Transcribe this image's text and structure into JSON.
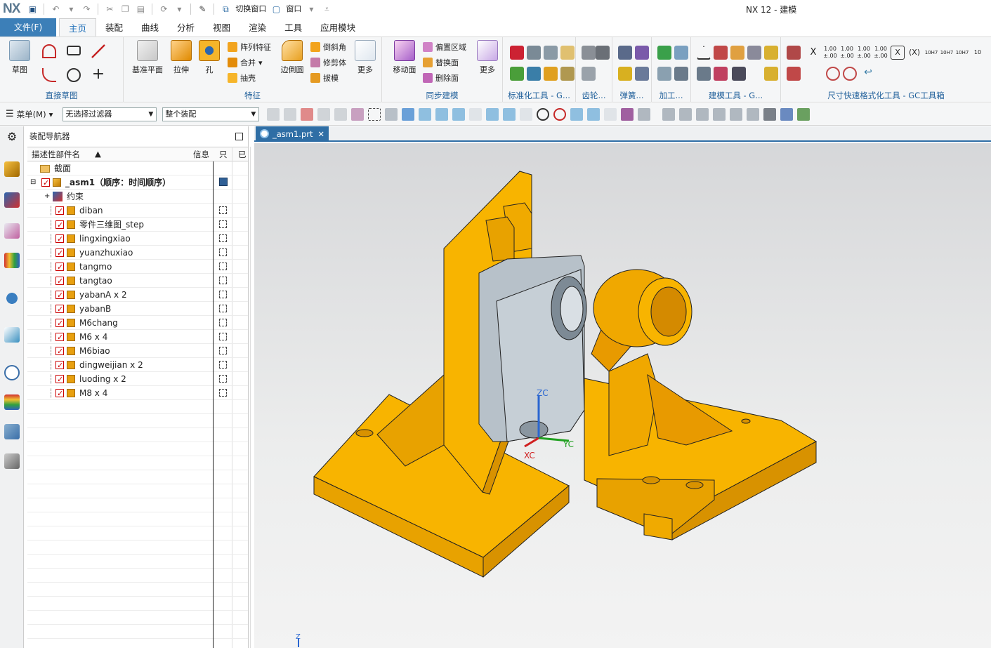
{
  "app": {
    "logo": "NX",
    "title": "NX 12 - 建模"
  },
  "quick_access": {
    "switch_window": "切换窗口",
    "window": "窗口"
  },
  "menubar": {
    "file": "文件(F)",
    "tabs": [
      "主页",
      "装配",
      "曲线",
      "分析",
      "视图",
      "渲染",
      "工具",
      "应用模块"
    ]
  },
  "ribbon": {
    "sketch": {
      "label": "草图",
      "group": "直接草图"
    },
    "feature": {
      "datum": "基准平面",
      "extrude": "拉伸",
      "hole": "孔",
      "pattern": "阵列特征",
      "unite": "合并",
      "shell": "抽壳",
      "edge_blend": "边倒圆",
      "chamfer": "倒斜角",
      "trim_body": "修剪体",
      "draft": "拔模",
      "more": "更多",
      "group": "特征"
    },
    "sync": {
      "move_face": "移动面",
      "offset_region": "偏置区域",
      "replace_face": "替换面",
      "delete_face": "删除面",
      "more": "更多",
      "group": "同步建模"
    },
    "std_tools": "标准化工具 - G...",
    "gear": "齿轮...",
    "spring": "弹簧...",
    "machining": "加工...",
    "build_tools": "建模工具 - G...",
    "dim_tools": "尺寸快速格式化工具 - GC工具箱",
    "dim_labels": [
      "X",
      "(X)",
      "10H7",
      "10H7",
      "10H7",
      "10"
    ]
  },
  "toolbar2": {
    "menu": "菜单(M)",
    "filter": "无选择过滤器",
    "assembly": "整个装配"
  },
  "navigator": {
    "title": "装配导航器",
    "col_name": "描述性部件名",
    "col_info": "信息",
    "col_ro": "只",
    "col_mod": "已",
    "section": "截面",
    "root": "_asm1（顺序：时间顺序）",
    "constraints": "约束",
    "parts": [
      "diban",
      "零件三维图_step",
      "lingxingxiao",
      "yuanzhuxiao",
      "tangmo",
      "tangtao",
      "yabanA x 2",
      "yabanB",
      "M6chang",
      "M6 x 4",
      "M6biao",
      "dingweijian x 2",
      "luoding x 2",
      "M8 x 4"
    ]
  },
  "doc_tab": "_asm1.prt",
  "viewport": {
    "axis_zc": "ZC",
    "axis_xc": "XC",
    "axis_yc": "YC",
    "triad_z": "Z"
  },
  "colors": {
    "accent": "#2f6ea5",
    "file_tab": "#3c7fb8",
    "part_orange": "#f5a800",
    "part_grey": "#aab4bd"
  }
}
